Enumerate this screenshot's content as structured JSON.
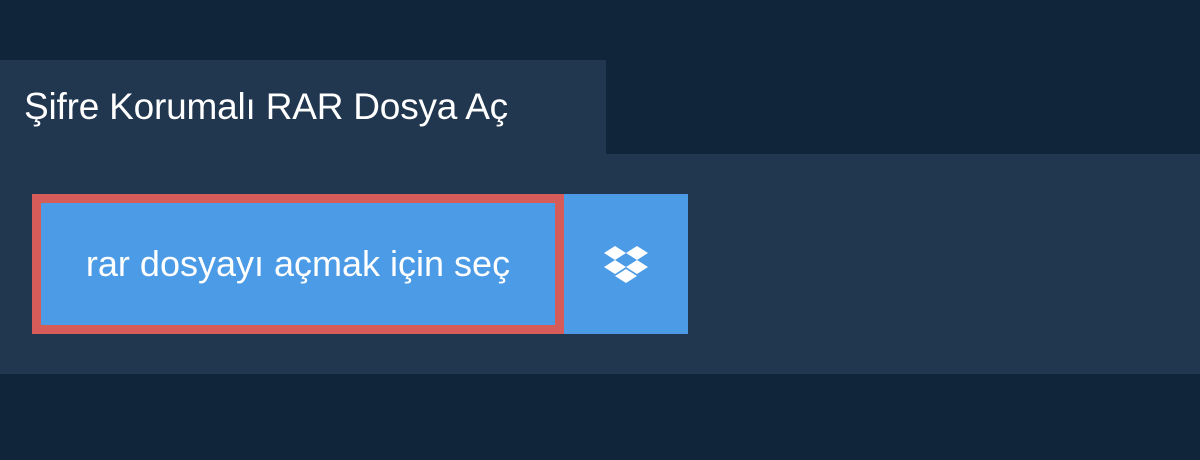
{
  "tab": {
    "title": "Şifre Korumalı RAR Dosya Aç"
  },
  "upload": {
    "select_label": "rar dosyayı açmak için seç",
    "dropbox_icon": "dropbox-icon"
  },
  "colors": {
    "background": "#10243a",
    "panel": "#21364f",
    "button": "#4c9be6",
    "button_border": "#d65c5a",
    "text": "#ffffff"
  }
}
